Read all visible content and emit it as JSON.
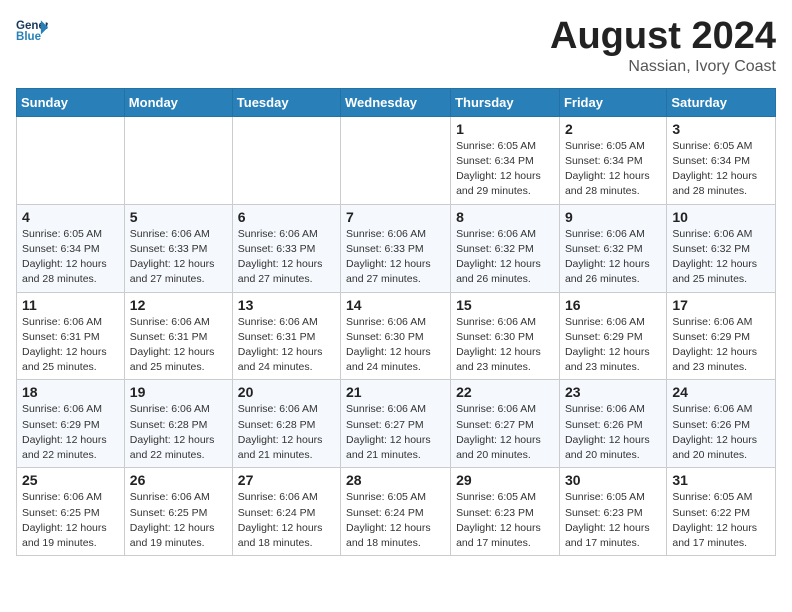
{
  "header": {
    "logo_line1": "General",
    "logo_line2": "Blue",
    "title": "August 2024",
    "subtitle": "Nassian, Ivory Coast"
  },
  "days_of_week": [
    "Sunday",
    "Monday",
    "Tuesday",
    "Wednesday",
    "Thursday",
    "Friday",
    "Saturday"
  ],
  "weeks": [
    [
      {
        "day": "",
        "info": ""
      },
      {
        "day": "",
        "info": ""
      },
      {
        "day": "",
        "info": ""
      },
      {
        "day": "",
        "info": ""
      },
      {
        "day": "1",
        "info": "Sunrise: 6:05 AM\nSunset: 6:34 PM\nDaylight: 12 hours\nand 29 minutes."
      },
      {
        "day": "2",
        "info": "Sunrise: 6:05 AM\nSunset: 6:34 PM\nDaylight: 12 hours\nand 28 minutes."
      },
      {
        "day": "3",
        "info": "Sunrise: 6:05 AM\nSunset: 6:34 PM\nDaylight: 12 hours\nand 28 minutes."
      }
    ],
    [
      {
        "day": "4",
        "info": "Sunrise: 6:05 AM\nSunset: 6:34 PM\nDaylight: 12 hours\nand 28 minutes."
      },
      {
        "day": "5",
        "info": "Sunrise: 6:06 AM\nSunset: 6:33 PM\nDaylight: 12 hours\nand 27 minutes."
      },
      {
        "day": "6",
        "info": "Sunrise: 6:06 AM\nSunset: 6:33 PM\nDaylight: 12 hours\nand 27 minutes."
      },
      {
        "day": "7",
        "info": "Sunrise: 6:06 AM\nSunset: 6:33 PM\nDaylight: 12 hours\nand 27 minutes."
      },
      {
        "day": "8",
        "info": "Sunrise: 6:06 AM\nSunset: 6:32 PM\nDaylight: 12 hours\nand 26 minutes."
      },
      {
        "day": "9",
        "info": "Sunrise: 6:06 AM\nSunset: 6:32 PM\nDaylight: 12 hours\nand 26 minutes."
      },
      {
        "day": "10",
        "info": "Sunrise: 6:06 AM\nSunset: 6:32 PM\nDaylight: 12 hours\nand 25 minutes."
      }
    ],
    [
      {
        "day": "11",
        "info": "Sunrise: 6:06 AM\nSunset: 6:31 PM\nDaylight: 12 hours\nand 25 minutes."
      },
      {
        "day": "12",
        "info": "Sunrise: 6:06 AM\nSunset: 6:31 PM\nDaylight: 12 hours\nand 25 minutes."
      },
      {
        "day": "13",
        "info": "Sunrise: 6:06 AM\nSunset: 6:31 PM\nDaylight: 12 hours\nand 24 minutes."
      },
      {
        "day": "14",
        "info": "Sunrise: 6:06 AM\nSunset: 6:30 PM\nDaylight: 12 hours\nand 24 minutes."
      },
      {
        "day": "15",
        "info": "Sunrise: 6:06 AM\nSunset: 6:30 PM\nDaylight: 12 hours\nand 23 minutes."
      },
      {
        "day": "16",
        "info": "Sunrise: 6:06 AM\nSunset: 6:29 PM\nDaylight: 12 hours\nand 23 minutes."
      },
      {
        "day": "17",
        "info": "Sunrise: 6:06 AM\nSunset: 6:29 PM\nDaylight: 12 hours\nand 23 minutes."
      }
    ],
    [
      {
        "day": "18",
        "info": "Sunrise: 6:06 AM\nSunset: 6:29 PM\nDaylight: 12 hours\nand 22 minutes."
      },
      {
        "day": "19",
        "info": "Sunrise: 6:06 AM\nSunset: 6:28 PM\nDaylight: 12 hours\nand 22 minutes."
      },
      {
        "day": "20",
        "info": "Sunrise: 6:06 AM\nSunset: 6:28 PM\nDaylight: 12 hours\nand 21 minutes."
      },
      {
        "day": "21",
        "info": "Sunrise: 6:06 AM\nSunset: 6:27 PM\nDaylight: 12 hours\nand 21 minutes."
      },
      {
        "day": "22",
        "info": "Sunrise: 6:06 AM\nSunset: 6:27 PM\nDaylight: 12 hours\nand 20 minutes."
      },
      {
        "day": "23",
        "info": "Sunrise: 6:06 AM\nSunset: 6:26 PM\nDaylight: 12 hours\nand 20 minutes."
      },
      {
        "day": "24",
        "info": "Sunrise: 6:06 AM\nSunset: 6:26 PM\nDaylight: 12 hours\nand 20 minutes."
      }
    ],
    [
      {
        "day": "25",
        "info": "Sunrise: 6:06 AM\nSunset: 6:25 PM\nDaylight: 12 hours\nand 19 minutes."
      },
      {
        "day": "26",
        "info": "Sunrise: 6:06 AM\nSunset: 6:25 PM\nDaylight: 12 hours\nand 19 minutes."
      },
      {
        "day": "27",
        "info": "Sunrise: 6:06 AM\nSunset: 6:24 PM\nDaylight: 12 hours\nand 18 minutes."
      },
      {
        "day": "28",
        "info": "Sunrise: 6:05 AM\nSunset: 6:24 PM\nDaylight: 12 hours\nand 18 minutes."
      },
      {
        "day": "29",
        "info": "Sunrise: 6:05 AM\nSunset: 6:23 PM\nDaylight: 12 hours\nand 17 minutes."
      },
      {
        "day": "30",
        "info": "Sunrise: 6:05 AM\nSunset: 6:23 PM\nDaylight: 12 hours\nand 17 minutes."
      },
      {
        "day": "31",
        "info": "Sunrise: 6:05 AM\nSunset: 6:22 PM\nDaylight: 12 hours\nand 17 minutes."
      }
    ]
  ]
}
